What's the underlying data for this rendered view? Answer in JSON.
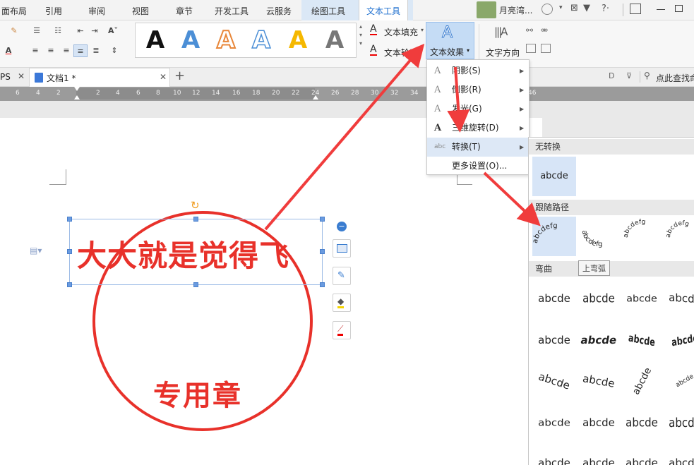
{
  "ribbon_tabs": [
    "面布局",
    "引用",
    "审阅",
    "视图",
    "章节",
    "开发工具",
    "云服务",
    "绘图工具",
    "文本工具"
  ],
  "user": {
    "name": "月亮湾..."
  },
  "toolbar": {
    "text_fill_label": "文本填充",
    "text_outline_label": "文本轮廓",
    "text_effects_label": "文本效果",
    "text_direction_label": "文字方向",
    "style_sample_letter": "A"
  },
  "doc_tabs": {
    "left_tab": "PS",
    "doc_tab": "文档1 *",
    "add_tab": "+"
  },
  "search_placeholder": "点此查找命",
  "ruler": {
    "ticks": [
      "6",
      "4",
      "2",
      "",
      "2",
      "4",
      "6",
      "8",
      "10",
      "12",
      "14",
      "16",
      "18",
      "20",
      "22",
      "24",
      "26",
      "28",
      "30",
      "32",
      "34",
      "36",
      "38",
      "40",
      "46"
    ]
  },
  "document": {
    "seal_company_text": "大大就是觉得飞",
    "seal_bottom_text": "专用章"
  },
  "effects_menu": {
    "items": [
      {
        "icon": "A",
        "label": "阴影(S)",
        "has_submenu": true
      },
      {
        "icon": "A",
        "label": "倒影(R)",
        "has_submenu": true
      },
      {
        "icon": "A",
        "label": "发光(G)",
        "has_submenu": true
      },
      {
        "icon": "A",
        "label": "三维旋转(D)",
        "has_submenu": true
      },
      {
        "icon": "abc",
        "label": "转换(T)",
        "has_submenu": true
      },
      {
        "icon": "",
        "label": "更多设置(O)...",
        "has_submenu": false
      }
    ]
  },
  "transform_gallery": {
    "no_transform_title": "无转换",
    "no_transform_sample": "abcde",
    "follow_path_title": "跟随路径",
    "follow_path_sample": "abcdefg",
    "tooltip": "上弯弧",
    "warp_title": "弯曲",
    "warp_sample": "abcde"
  },
  "colors": {
    "accent_red": "#e8312a",
    "ribbon_active": "#1e6fcf",
    "arrow_red": "#f03c3c"
  }
}
